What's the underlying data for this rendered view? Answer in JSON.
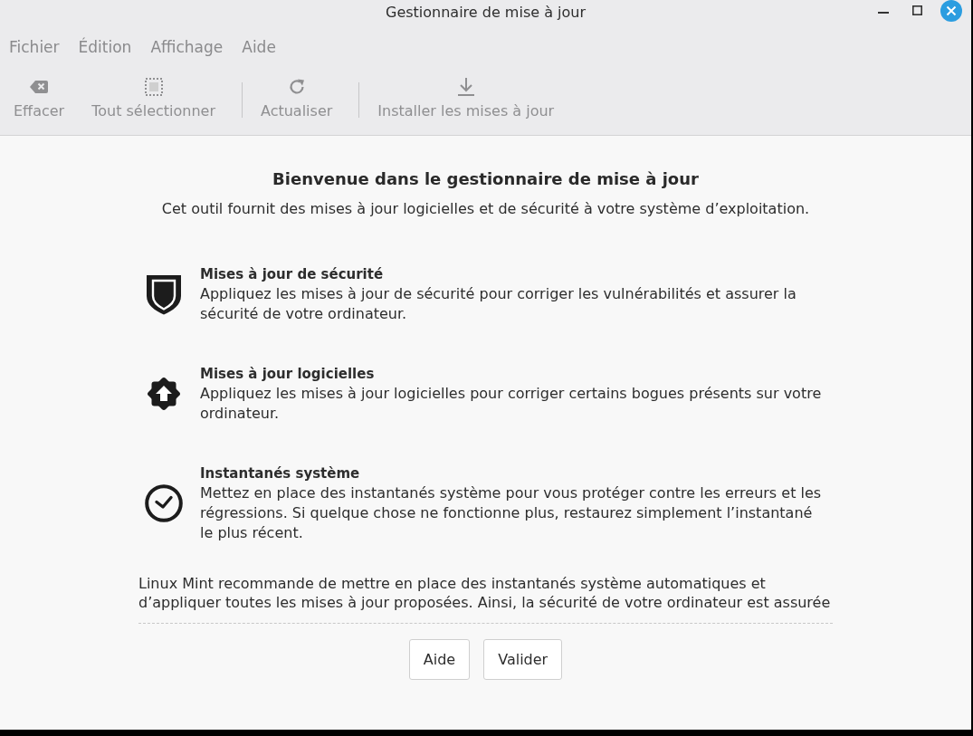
{
  "window": {
    "title": "Gestionnaire de mise à jour"
  },
  "menu_bar": [
    {
      "label": "Fichier"
    },
    {
      "label": "Édition"
    },
    {
      "label": "Affichage"
    },
    {
      "label": "Aide"
    }
  ],
  "toolbar": [
    {
      "kind": "button",
      "label": "Effacer",
      "disabled": true
    },
    {
      "kind": "button",
      "label": "Tout sélectionner",
      "disabled": true
    },
    {
      "kind": "separator"
    },
    {
      "kind": "button",
      "label": "Actualiser",
      "disabled": true
    },
    {
      "kind": "separator"
    },
    {
      "kind": "button",
      "label": "Installer les mises à jour",
      "disabled": true
    }
  ],
  "welcome": {
    "heading": "Bienvenue dans le gestionnaire de mise à jour",
    "subtitle": "Cet outil fournit des mises à jour logicielles et de sécurité à votre système d’exploitation.",
    "features": [
      {
        "title": "Mises à jour de sécurité",
        "description": "Appliquez les mises à jour de sécurité pour corriger les vulnérabilités et assurer la sécurité de votre ordinateur."
      },
      {
        "title": "Mises à jour logicielles",
        "description": "Appliquez les mises à jour logicielles pour corriger certains bogues présents sur votre ordinateur."
      },
      {
        "title": "Instantanés système",
        "description": "Mettez en place des instantanés système pour vous protéger contre les erreurs et les régressions. Si quelque chose ne fonctionne plus, restaurez simplement l’instantané le plus récent."
      }
    ],
    "recommendation": "Linux Mint recommande de mettre en place des instantanés système automatiques et d’appliquer toutes les mises à jour proposées. Ainsi, la sécurité de votre ordinateur est assurée"
  },
  "buttons": [
    {
      "label": "Aide"
    },
    {
      "label": "Valider"
    }
  ]
}
